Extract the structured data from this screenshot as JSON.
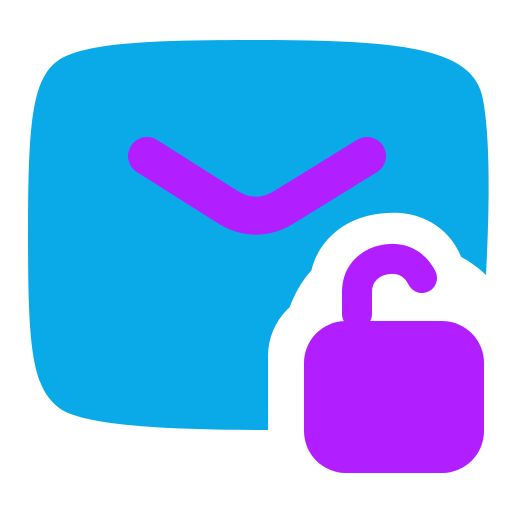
{
  "icon": {
    "name": "mail-unlock-icon",
    "parts": {
      "envelope": "envelope-icon",
      "envelope_flap": "envelope-flap-icon",
      "padlock": "unlocked-padlock-icon"
    }
  },
  "colors": {
    "background": "#ffffff",
    "envelope": "#0AAAE8",
    "accent": "#B11EFF",
    "cutout": "#ffffff"
  }
}
